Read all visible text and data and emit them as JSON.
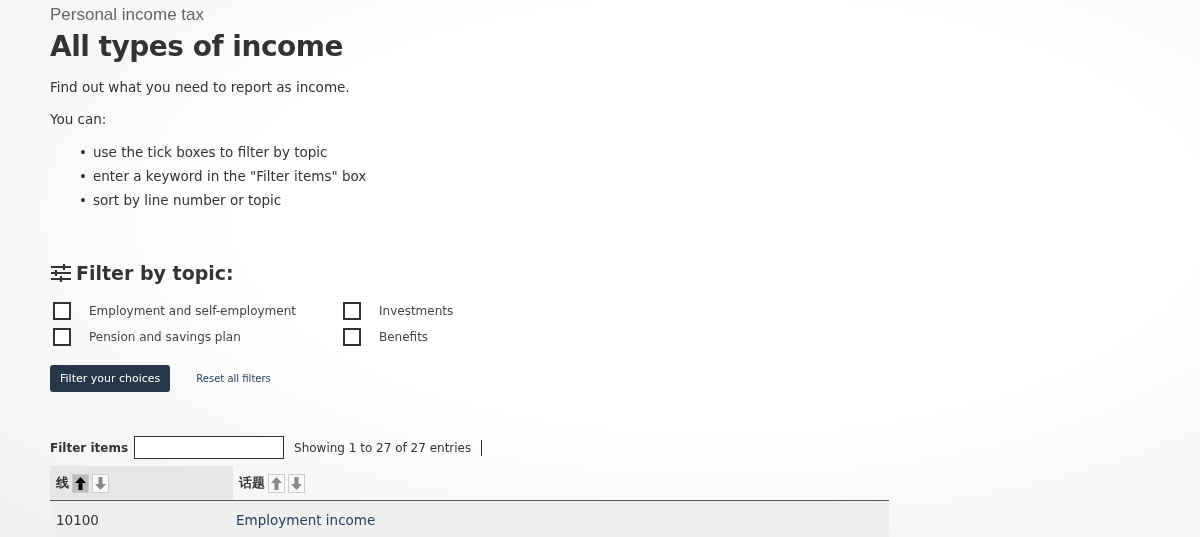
{
  "breadcrumb": "Personal income tax",
  "title": "All types of income",
  "intro": "Find out what you need to report as income.",
  "lead": "You can:",
  "bullets": [
    {
      "marker": "•",
      "text": "use the tick boxes to filter by topic"
    },
    {
      "marker": "•",
      "text": "enter a keyword in the \"Filter items\" box"
    },
    {
      "marker": "•",
      "text": "sort by line number or topic"
    }
  ],
  "filter": {
    "heading": "Filter by topic:",
    "options": [
      {
        "label": "Employment and self-employment",
        "checked": false
      },
      {
        "label": "Investments",
        "checked": false
      },
      {
        "label": "Pension and savings plan",
        "checked": false
      },
      {
        "label": "Benefits",
        "checked": false
      }
    ],
    "apply_button": "Filter your choices",
    "reset_link": "Reset all filters"
  },
  "table": {
    "filter_label": "Filter items",
    "info": "Showing 1 to 27 of 27 entries",
    "columns": [
      {
        "label": "线",
        "sorted_ascending": true
      },
      {
        "label": "话题",
        "sorted_ascending": false
      }
    ],
    "rows": [
      {
        "line": "10100",
        "topic": "Employment income"
      }
    ]
  }
}
